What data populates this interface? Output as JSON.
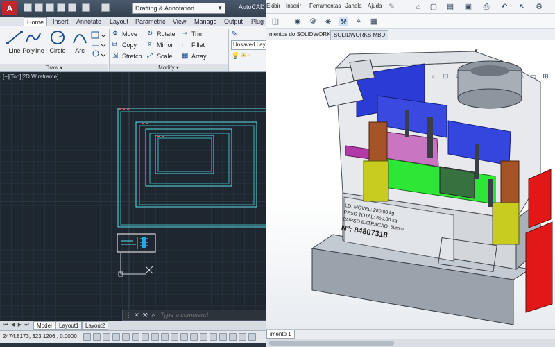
{
  "autocad": {
    "logo": "A",
    "workspace": "Drafting & Annotation",
    "app_title": "AutoCAD",
    "quick_access": [
      "new-icon",
      "open-icon",
      "save-icon",
      "save-as-icon",
      "plot-icon",
      "undo-icon",
      "redo-icon"
    ],
    "ribbon_tabs": [
      "Home",
      "Insert",
      "Annotate",
      "Layout",
      "Parametric",
      "View",
      "Manage",
      "Output",
      "Plug-"
    ],
    "draw": {
      "tools": [
        "Line",
        "Polyline",
        "Circle",
        "Arc"
      ],
      "panel_label": "Draw"
    },
    "modify": {
      "row1": [
        "Move",
        "Rotate",
        "Trim"
      ],
      "row2": [
        "Copy",
        "Mirror",
        "Fillet"
      ],
      "row3": [
        "Stretch",
        "Scale",
        "Array"
      ],
      "panel_label": "Modify"
    },
    "layer": {
      "value": "Unsaved Lay"
    },
    "viewport_label": "[−][Top][2D Wireframe]",
    "command": {
      "placeholder": "Type a command"
    },
    "layout_tabs": [
      "Model",
      "Layout1",
      "Layout2"
    ],
    "coordinates": "2474.8173, 323.1206 , 0.0000"
  },
  "solidworks": {
    "menu": [
      "Exibir",
      "Inserir",
      "Ferramentas",
      "Janela",
      "Ajuda"
    ],
    "tabs": [
      "mentos do SOLIDWORKS",
      "SOLIDWORKS MBD"
    ],
    "active_tab_index": 1,
    "footer_tab": "imento 1",
    "part_label": {
      "line1": "LD. MOVEL: 280,00 kg",
      "line2": "PESO TOTAL: 560,00 kg",
      "line3": "CURSO EXTRACAO: 50mm",
      "number": "Nº: 84807318"
    }
  },
  "colors": {
    "cad_bg": "#1e262f",
    "cad_lines": "#5fe0e8",
    "sw_bg": "#ffffff",
    "accent_red": "#c0262b"
  }
}
